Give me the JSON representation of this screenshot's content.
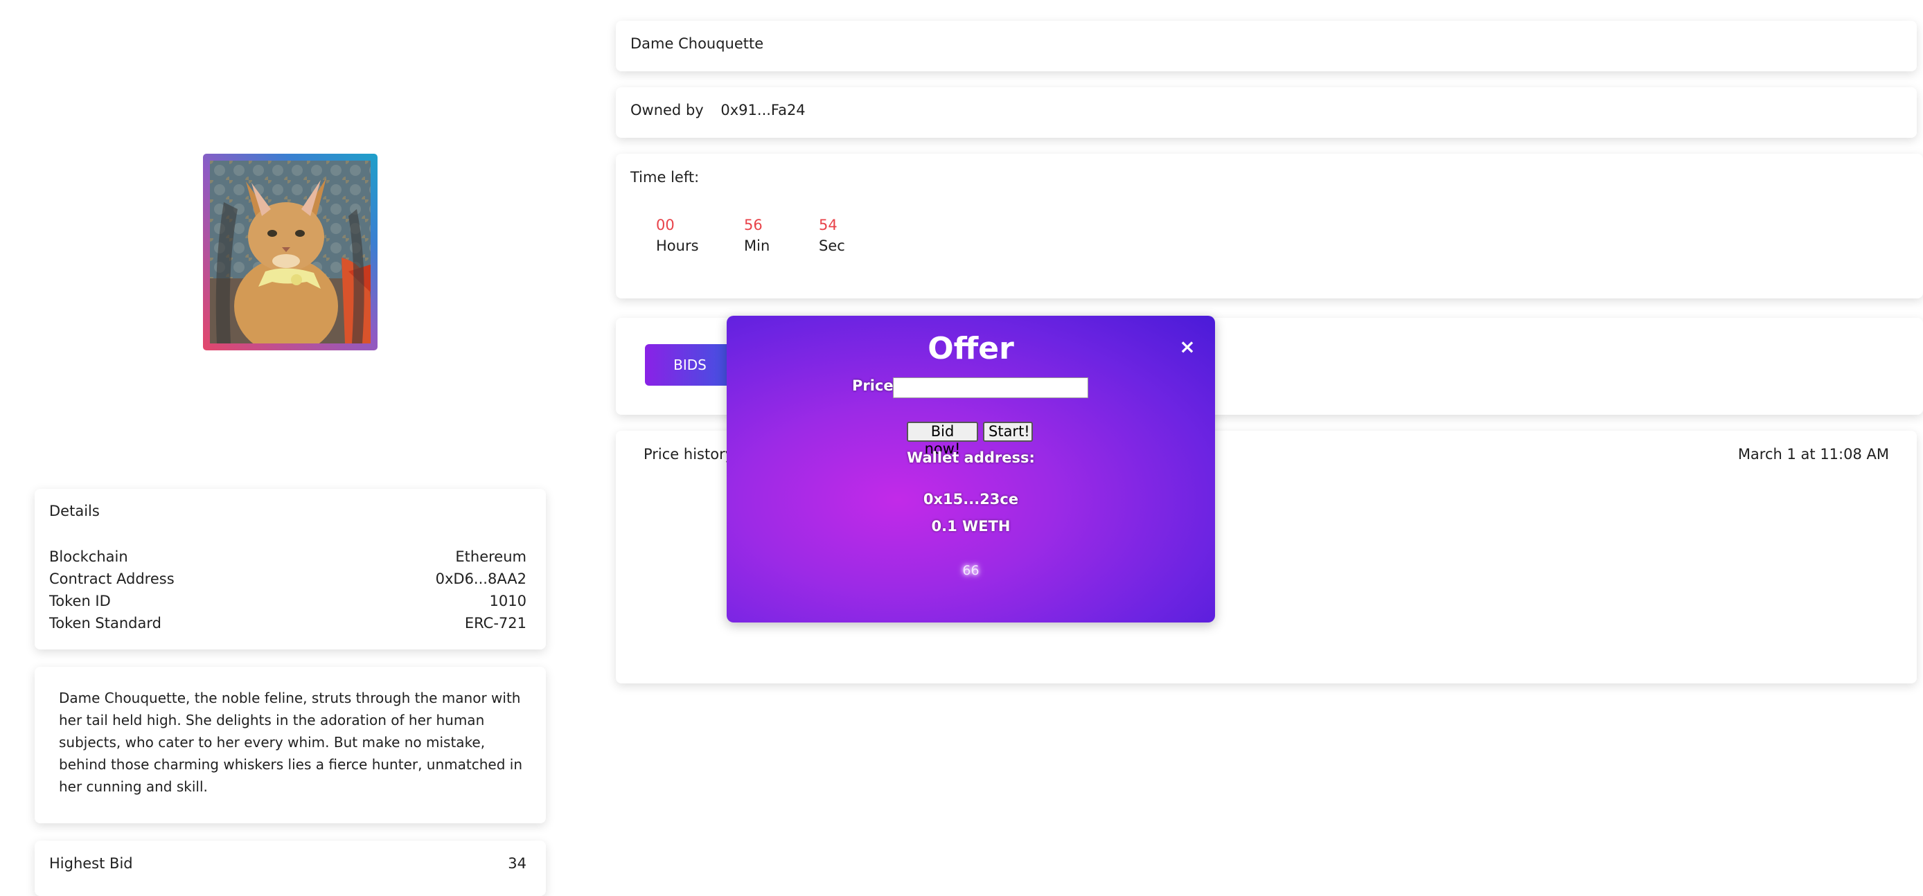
{
  "nft": {
    "name": "Dame Chouquette",
    "owner_label": "Owned by",
    "owner": "0x91...Fa24",
    "time_left_label": "Time left:",
    "countdown": [
      {
        "value": "00",
        "label": "Hours"
      },
      {
        "value": "56",
        "label": "Min"
      },
      {
        "value": "54",
        "label": "Sec"
      }
    ]
  },
  "details": {
    "title": "Details",
    "rows": [
      {
        "label": "Blockchain",
        "value": "Ethereum"
      },
      {
        "label": "Contract Address",
        "value": "0xD6...8AA2"
      },
      {
        "label": "Token ID",
        "value": "1010"
      },
      {
        "label": "Token Standard",
        "value": "ERC-721"
      }
    ]
  },
  "description": "Dame Chouquette, the noble feline, struts through the manor with her tail held high. She delights in the adoration of her human subjects, who cater to her every whim. But make no mistake, behind those charming whiskers lies a fierce hunter, unmatched in her cunning and skill.",
  "highest_bid": {
    "label": "Highest Bid",
    "value": "34"
  },
  "bids_tab": {
    "label": "BIDS"
  },
  "price_history": {
    "label": "Price history",
    "date": "March 1 at 11:08 AM"
  },
  "modal": {
    "title": "Offer",
    "close": "×",
    "price_label": "Price:",
    "price_value": "",
    "bid_button": "Bid now!",
    "start_button": "Start!",
    "wallet_label": "Wallet address:",
    "wallet": "0x15...23ce",
    "amount": "0.1 WETH",
    "counter": "66"
  },
  "colors": {
    "countdown": "#e8434a",
    "modal_start": "#c22ae8",
    "modal_end": "#4a1bd8",
    "bids_gradient": [
      "#8a22e6",
      "#3e55e0"
    ]
  }
}
